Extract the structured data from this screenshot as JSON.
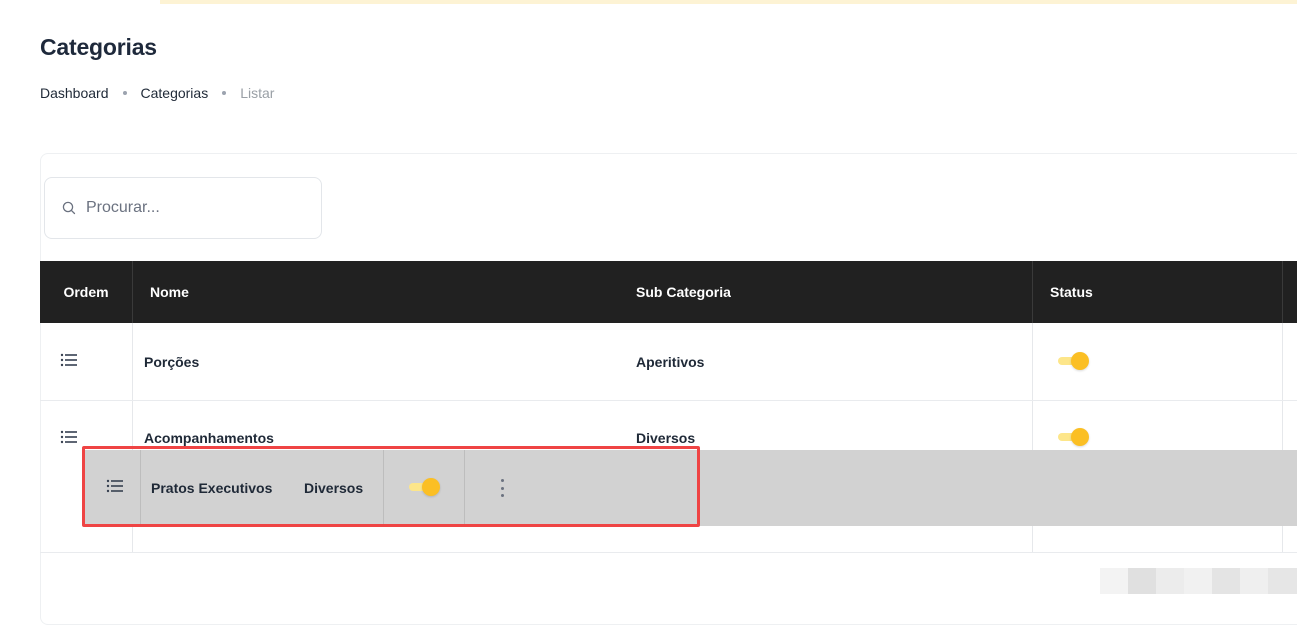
{
  "page": {
    "title": "Categorias",
    "breadcrumb": [
      "Dashboard",
      "Categorias",
      "Listar"
    ]
  },
  "search": {
    "placeholder": "Procurar...",
    "value": ""
  },
  "table": {
    "columns": [
      "Ordem",
      "Nome",
      "Sub Categoria",
      "Status"
    ],
    "rows": [
      {
        "nome": "Porções",
        "sub_categoria": "Aperitivos",
        "status": true
      },
      {
        "nome": "Acompanhamentos",
        "sub_categoria": "Diversos",
        "status": true
      }
    ],
    "dragging_row": {
      "nome": "Pratos Executivos",
      "sub_categoria": "Diversos",
      "status": true
    }
  },
  "icons": {
    "search": "search-icon",
    "drag": "list-drag-icon",
    "menu": "kebab-menu-icon"
  },
  "colors": {
    "header_bg": "#212121",
    "toggle_on": "#fbbf24",
    "highlight": "#ef4444",
    "drag_ghost_bg": "#d2d2d2"
  }
}
